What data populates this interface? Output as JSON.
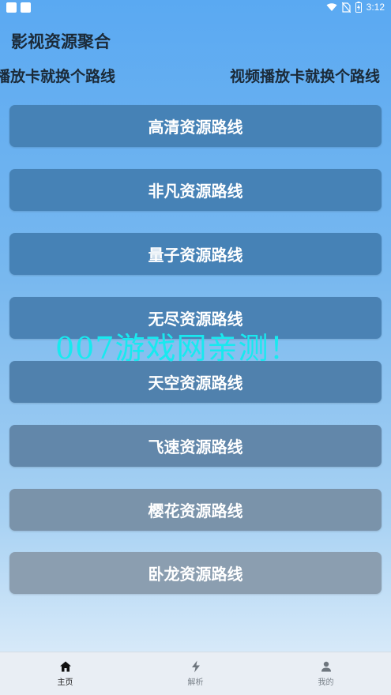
{
  "status_bar": {
    "time": "3:12",
    "icons": [
      "wifi-icon",
      "no-sim-icon",
      "battery-charging-icon"
    ]
  },
  "app": {
    "title": "影视资源聚合",
    "marquee_left": "播放卡就换个路线",
    "marquee_right": "视频播放卡就换个路线"
  },
  "routes": [
    {
      "label": "高清资源路线",
      "color": "#4682b6"
    },
    {
      "label": "非凡资源路线",
      "color": "#4682b6"
    },
    {
      "label": "量子资源路线",
      "color": "#4682b6"
    },
    {
      "label": "无尽资源路线",
      "color": "#4a82b4"
    },
    {
      "label": "天空资源路线",
      "color": "#5081ad"
    },
    {
      "label": "飞速资源路线",
      "color": "#6287aa"
    },
    {
      "label": "樱花资源路线",
      "color": "#7a93aa"
    },
    {
      "label": "卧龙资源路线",
      "color": "#8b9eb0"
    }
  ],
  "watermark": "007游戏网亲测！",
  "bottom_nav": [
    {
      "label": "主页",
      "icon": "home-icon",
      "active": true
    },
    {
      "label": "解析",
      "icon": "lightning-icon",
      "active": false
    },
    {
      "label": "我的",
      "icon": "user-icon",
      "active": false
    }
  ]
}
